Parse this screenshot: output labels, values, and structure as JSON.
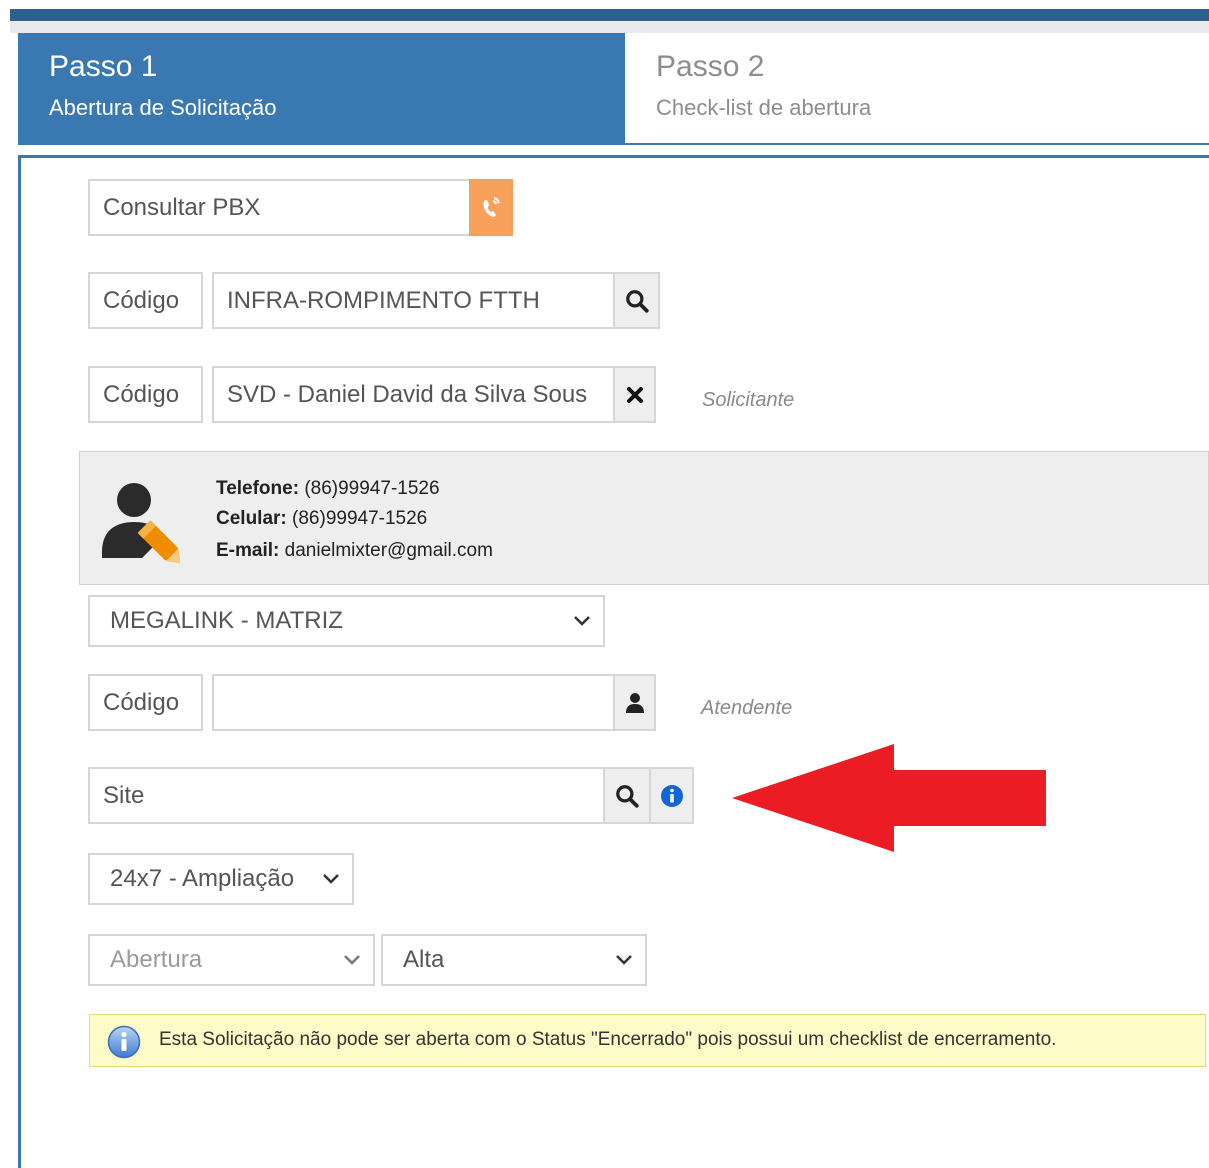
{
  "steps": [
    {
      "title": "Passo 1",
      "subtitle": "Abertura de Solicitação"
    },
    {
      "title": "Passo 2",
      "subtitle": "Check-list de abertura"
    }
  ],
  "pbx": {
    "label": "Consultar PBX",
    "icon": "phone-ring-icon",
    "accent": "#f7a15a"
  },
  "servico": {
    "code_label": "Código",
    "value": "INFRA-ROMPIMENTO FTTH",
    "icon": "search-icon"
  },
  "solicitante": {
    "code_label": "Código",
    "value": "SVD - Daniel David da Silva Sous",
    "icon": "close-icon",
    "label": "Solicitante"
  },
  "contact": {
    "phone_label": "Telefone:",
    "phone": "(86)99947-1526",
    "mobile_label": "Celular:",
    "mobile": "(86)99947-1526",
    "email_label": "E-mail:",
    "email": "danielmixter@gmail.com",
    "icon": "user-edit-icon"
  },
  "empresa": {
    "selected": "MEGALINK - MATRIZ"
  },
  "atendente": {
    "code_label": "Código",
    "value": "",
    "icon": "user-icon",
    "label": "Atendente"
  },
  "site": {
    "placeholder": "Site",
    "search_icon": "search-icon",
    "info_icon": "info-circle-icon",
    "annotation_color": "#ec1c24"
  },
  "fila": {
    "selected": "24x7 - Ampliação"
  },
  "status": {
    "selected": "Abertura"
  },
  "prioridade": {
    "selected": "Alta"
  },
  "alert": {
    "message": "Esta Solicitação não pode ser aberta com o Status \"Encerrado\" pois possui um checklist de encerramento.",
    "icon": "info-icon"
  },
  "colors": {
    "primary": "#3a78b1",
    "dark": "#2f5f8c",
    "alert_bg": "#fdfbc8"
  }
}
